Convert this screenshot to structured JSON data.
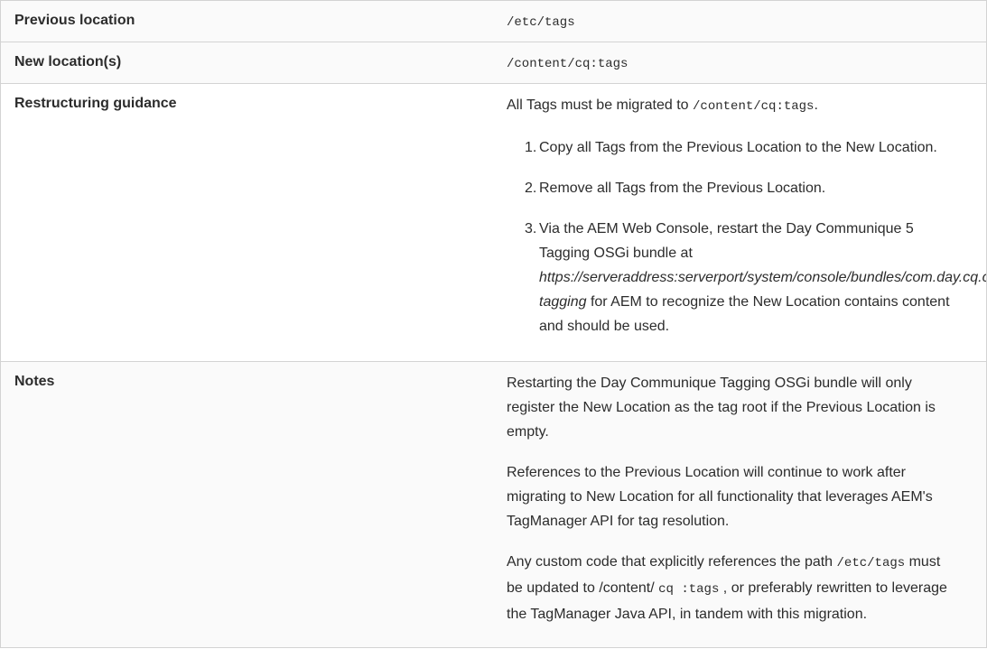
{
  "rows": {
    "previous": {
      "label": "Previous location",
      "value": "/etc/tags"
    },
    "new": {
      "label": "New location(s)",
      "value": "/content/cq:tags"
    },
    "guidance": {
      "label": "Restructuring guidance",
      "intro_text": "All Tags must be migrated to ",
      "intro_code": "/content/cq:tags",
      "intro_end": ".",
      "steps": [
        {
          "num": "1.",
          "text": "Copy all Tags from the Previous Location to the New Location."
        },
        {
          "num": "2.",
          "text": "Remove all Tags from the Previous Location."
        }
      ],
      "step3": {
        "num": "3.",
        "line1": "Via the AEM Web Console, restart the Day Communique 5",
        "line2": "Tagging OSGi bundle at",
        "url_part1": "https://serveraddress:serverport/system/console/bundles/com.day.cq.cq-",
        "url_part2": "tagging",
        "line4_rest": " for AEM to recognize the New Location contains content",
        "line5": "and should be used."
      }
    },
    "notes": {
      "label": "Notes",
      "p1_line1": "Restarting the Day Communique Tagging OSGi bundle will only",
      "p1_line2": "register the New Location as the tag root if the Previous Location is",
      "p1_line3": "empty.",
      "p2_line1": "References to the Previous Location will continue to work after",
      "p2_line2": "migrating to New Location for all functionality that leverages AEM's",
      "p2_line3": "TagManager API for tag resolution.",
      "p3_a": "Any custom code that explicitly references the path ",
      "p3_code1": "/etc/tags",
      "p3_b": " must",
      "p3_c": "be updated to /content/ ",
      "p3_code2": "cq :tags",
      "p3_d": " , or preferably rewritten to leverage",
      "p3_line3": "the TagManager Java API, in tandem with this migration."
    }
  }
}
